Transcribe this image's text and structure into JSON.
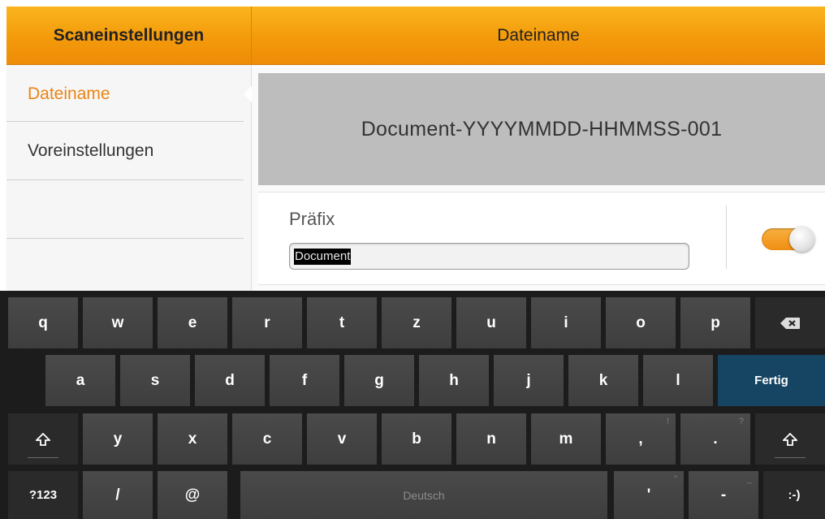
{
  "header": {
    "left_title": "Scaneinstellungen",
    "right_title": "Dateiname"
  },
  "sidebar": {
    "items": [
      {
        "label": "Dateiname",
        "active": true
      },
      {
        "label": "Voreinstellungen",
        "active": false
      },
      {
        "label": ""
      }
    ]
  },
  "main": {
    "preview_filename": "Document-YYYYMMDD-HHMMSS-001",
    "prefix": {
      "label": "Präfix",
      "value": "Document",
      "toggle_on": true
    }
  },
  "colors": {
    "accent": "#f39a0b",
    "active_text": "#e98514",
    "done_key": "#154563"
  },
  "keyboard": {
    "row1": [
      "q",
      "w",
      "e",
      "r",
      "t",
      "z",
      "u",
      "i",
      "o",
      "p"
    ],
    "backspace_icon": "backspace-icon",
    "row2": [
      "a",
      "s",
      "d",
      "f",
      "g",
      "h",
      "j",
      "k",
      "l"
    ],
    "done_label": "Fertig",
    "shift_icon": "shift-icon",
    "row3": [
      "y",
      "x",
      "c",
      "v",
      "b",
      "n",
      "m"
    ],
    "comma": ",",
    "comma_hint": "!",
    "period": ".",
    "period_hint": "?",
    "symbols_label": "?123",
    "slash": "/",
    "at": "@",
    "space_label": "Deutsch",
    "apostrophe": "'",
    "apostrophe_hint": "\"",
    "dash": "-",
    "dash_hint": "_",
    "smiley": ":-)"
  }
}
